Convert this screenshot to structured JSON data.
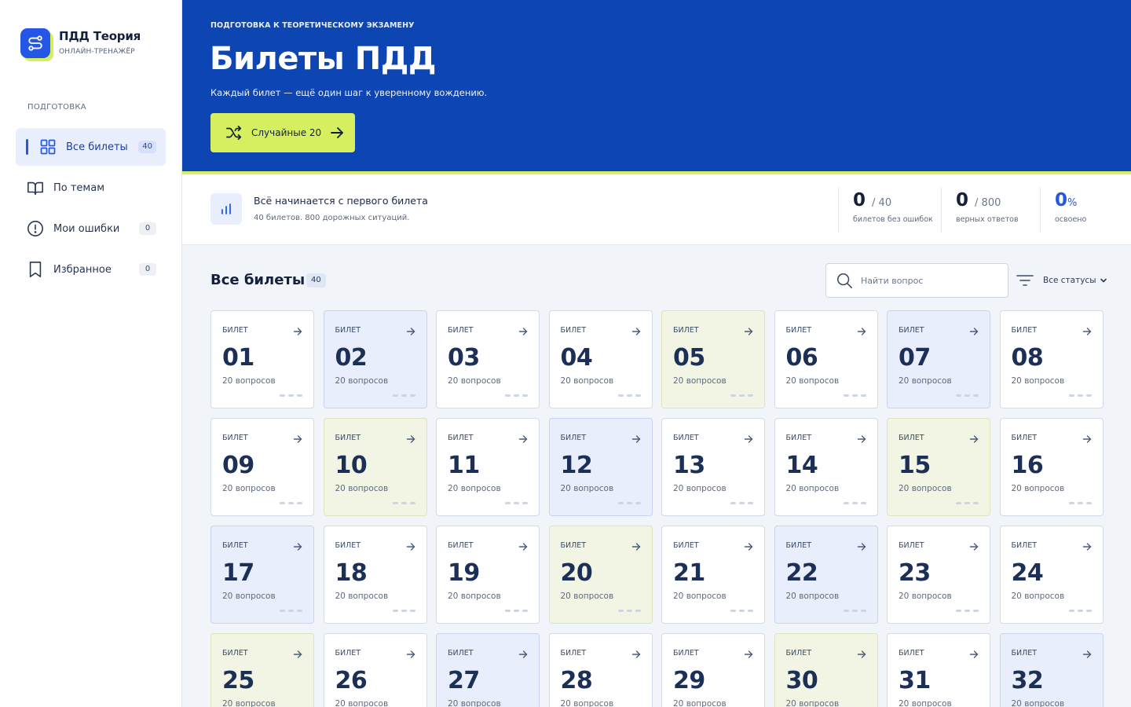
{
  "brand": {
    "title": "ПДД Теория",
    "subtitle": "ОНЛАЙН-ТРЕНАЖЁР"
  },
  "sidebar": {
    "section_label": "ПОДГОТОВКА",
    "items": [
      {
        "label": "Все билеты",
        "badge": "40",
        "icon": "grid-icon",
        "active": true
      },
      {
        "label": "По темам",
        "badge": "",
        "icon": "book-icon",
        "active": false
      },
      {
        "label": "Мои ошибки",
        "badge": "0",
        "icon": "alert-circle-icon",
        "active": false
      },
      {
        "label": "Избранное",
        "badge": "0",
        "icon": "bookmark-icon",
        "active": false
      }
    ]
  },
  "hero": {
    "eyebrow": "ПОДГОТОВКА К ТЕОРЕТИЧЕСКОМУ ЭКЗАМЕНУ",
    "title": "Билеты ПДД",
    "subtitle": "Каждый билет — ещё один шаг к уверенному вождению.",
    "button_label": "Случайные 20"
  },
  "strip": {
    "title": "Всё начинается с первого билета",
    "subtitle": "40 билетов. 800 дорожных ситуаций.",
    "stats": [
      {
        "value": "0",
        "of": "/ 40",
        "label": "билетов без ошибок"
      },
      {
        "value": "0",
        "of": "/ 800",
        "label": "верных ответов"
      },
      {
        "value": "0",
        "of": "%",
        "label": "освоено"
      }
    ]
  },
  "main": {
    "title": "Все билеты",
    "count": "40",
    "search_placeholder": "Найти вопрос",
    "filter_label": "Все статусы"
  },
  "ticket_label": "БИЛЕТ",
  "ticket_count_text": "20 вопросов",
  "tickets": [
    {
      "num": "01",
      "tint": "white"
    },
    {
      "num": "02",
      "tint": "blue"
    },
    {
      "num": "03",
      "tint": "white"
    },
    {
      "num": "04",
      "tint": "white"
    },
    {
      "num": "05",
      "tint": "green"
    },
    {
      "num": "06",
      "tint": "white"
    },
    {
      "num": "07",
      "tint": "blue"
    },
    {
      "num": "08",
      "tint": "white"
    },
    {
      "num": "09",
      "tint": "white"
    },
    {
      "num": "10",
      "tint": "green"
    },
    {
      "num": "11",
      "tint": "white"
    },
    {
      "num": "12",
      "tint": "blue"
    },
    {
      "num": "13",
      "tint": "white"
    },
    {
      "num": "14",
      "tint": "white"
    },
    {
      "num": "15",
      "tint": "green"
    },
    {
      "num": "16",
      "tint": "white"
    },
    {
      "num": "17",
      "tint": "blue"
    },
    {
      "num": "18",
      "tint": "white"
    },
    {
      "num": "19",
      "tint": "white"
    },
    {
      "num": "20",
      "tint": "green"
    },
    {
      "num": "21",
      "tint": "white"
    },
    {
      "num": "22",
      "tint": "blue"
    },
    {
      "num": "23",
      "tint": "white"
    },
    {
      "num": "24",
      "tint": "white"
    },
    {
      "num": "25",
      "tint": "green"
    },
    {
      "num": "26",
      "tint": "white"
    },
    {
      "num": "27",
      "tint": "blue"
    },
    {
      "num": "28",
      "tint": "white"
    },
    {
      "num": "29",
      "tint": "white"
    },
    {
      "num": "30",
      "tint": "green"
    },
    {
      "num": "31",
      "tint": "white"
    },
    {
      "num": "32",
      "tint": "blue"
    }
  ],
  "colors": {
    "primary": "#0d45b3",
    "accent": "#2457e6",
    "lime": "#d5ef5f",
    "tint_blue": "#e8eefc",
    "tint_green": "#f2f5e3"
  }
}
